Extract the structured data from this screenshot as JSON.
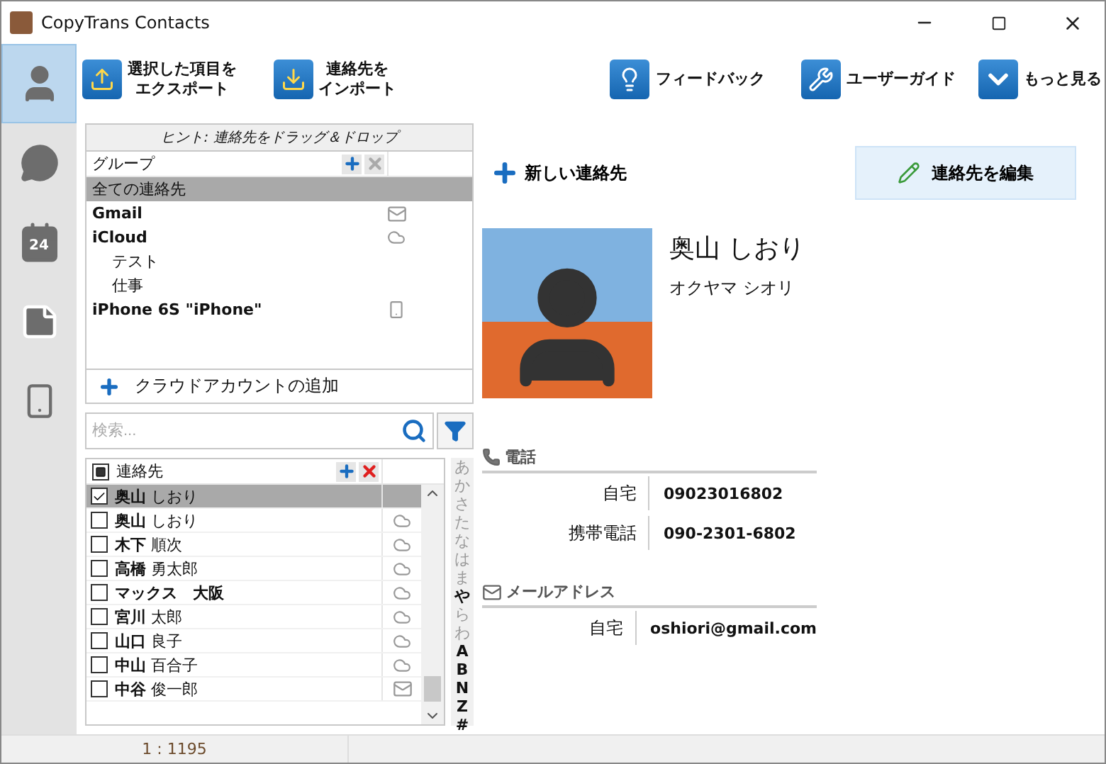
{
  "window": {
    "title": "CopyTrans Contacts"
  },
  "sidebar": {
    "items": [
      {
        "kind": "contacts",
        "selected": true
      },
      {
        "kind": "messages",
        "selected": false
      },
      {
        "kind": "calendar",
        "selected": false,
        "badge": "24"
      },
      {
        "kind": "notes",
        "selected": false
      },
      {
        "kind": "device",
        "selected": false
      }
    ]
  },
  "toolbar": [
    {
      "kind": "export",
      "lines": [
        "選択した項目を",
        "エクスポート"
      ]
    },
    {
      "kind": "import",
      "lines": [
        "連絡先を",
        "インポート"
      ]
    },
    {
      "kind": "feedback",
      "lines": [
        "フィードバック"
      ]
    },
    {
      "kind": "guide",
      "lines": [
        "ユーザーガイド"
      ]
    },
    {
      "kind": "more",
      "lines": [
        "もっと見る"
      ]
    }
  ],
  "groups": {
    "hint": "ヒント: 連絡先をドラッグ＆ドロップ",
    "header": "グループ",
    "items": [
      {
        "label": "全ての連絡先",
        "kind": "all",
        "selected": true
      },
      {
        "label": "Gmail",
        "kind": "mail",
        "selected": false
      },
      {
        "label": "iCloud",
        "kind": "cloud",
        "selected": false,
        "children": [
          {
            "label": "テスト",
            "kind": "folder",
            "selected": false
          },
          {
            "label": "仕事",
            "kind": "folder",
            "selected": false
          }
        ]
      },
      {
        "label": "iPhone 6S \"iPhone\"",
        "kind": "phone",
        "selected": false
      }
    ],
    "add_account": "クラウドアカウントの追加"
  },
  "search": {
    "placeholder": "検索..."
  },
  "contacts": {
    "header": "連絡先",
    "all_checked": false,
    "rows": [
      {
        "name": "**奥山** しおり",
        "kind": "none",
        "checked": true,
        "selected": true
      },
      {
        "name": "**奥山** しおり",
        "kind": "cloud",
        "checked": false,
        "selected": false
      },
      {
        "name": "**木下** 順次",
        "kind": "cloud",
        "checked": false,
        "selected": false
      },
      {
        "name": "**高橋** 勇太郎",
        "kind": "cloud",
        "checked": false,
        "selected": false
      },
      {
        "name": "**マックス　大阪**",
        "kind": "cloud",
        "checked": false,
        "selected": false
      },
      {
        "name": "**宮川** 太郎",
        "kind": "cloud",
        "checked": false,
        "selected": false
      },
      {
        "name": "**山口** 良子",
        "kind": "cloud",
        "checked": false,
        "selected": false
      },
      {
        "name": "**中山** 百合子",
        "kind": "cloud",
        "checked": false,
        "selected": false
      },
      {
        "name": "**中谷** 俊一郎",
        "kind": "mail",
        "checked": false,
        "selected": false
      }
    ]
  },
  "alpha_index": [
    {
      "label": "あ",
      "active": false
    },
    {
      "label": "か",
      "active": false
    },
    {
      "label": "さ",
      "active": false
    },
    {
      "label": "た",
      "active": false
    },
    {
      "label": "な",
      "active": false
    },
    {
      "label": "は",
      "active": false
    },
    {
      "label": "ま",
      "active": false
    },
    {
      "label": "や",
      "active": true
    },
    {
      "label": "ら",
      "active": false
    },
    {
      "label": "わ",
      "active": false
    },
    {
      "label": "A",
      "active": true
    },
    {
      "label": "B",
      "active": true
    },
    {
      "label": "N",
      "active": true
    },
    {
      "label": "Z",
      "active": true
    },
    {
      "label": "#",
      "active": true
    }
  ],
  "detail": {
    "new_contact": "新しい連絡先",
    "edit_contact": "連絡先を編集",
    "name": "奥山 しおり",
    "reading": "オクヤマ シオリ",
    "sections": [
      {
        "kind": "phone",
        "title": "電話",
        "entries": [
          {
            "label": "自宅",
            "value": "09023016802"
          },
          {
            "label": "携帯電話",
            "value": "090-2301-6802"
          }
        ]
      },
      {
        "kind": "email",
        "title": "メールアドレス",
        "entries": [
          {
            "label": "自宅",
            "value": "oshiori@gmail.com"
          }
        ]
      }
    ]
  },
  "status_bar": {
    "count": "1 : 1195"
  }
}
